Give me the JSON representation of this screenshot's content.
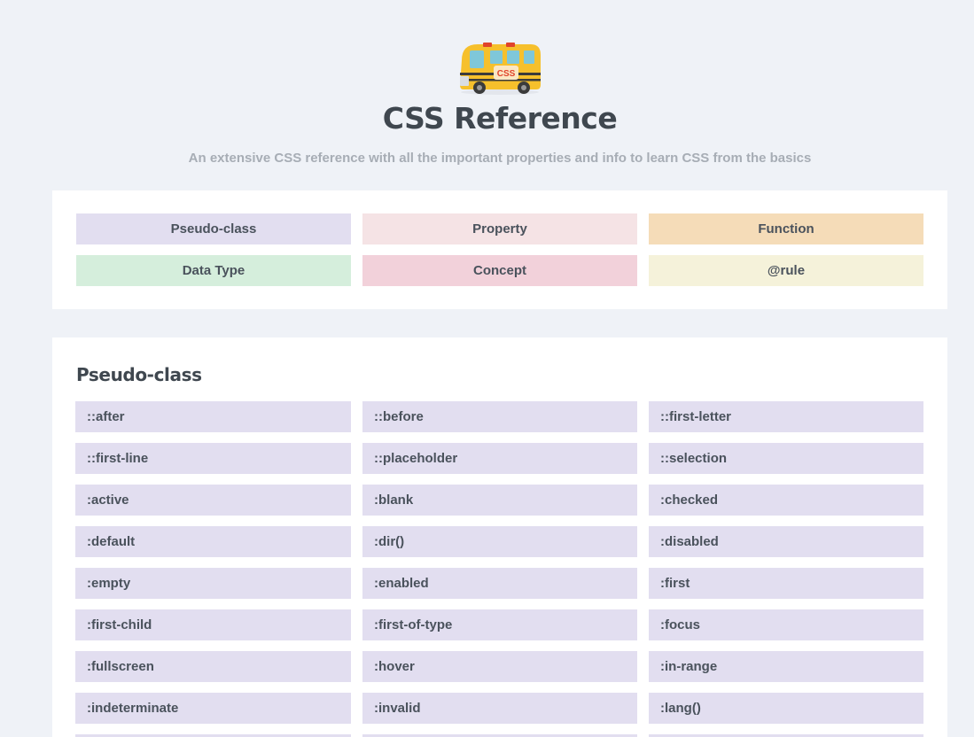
{
  "header": {
    "title": "CSS Reference",
    "subtitle": "An extensive CSS reference with all the important properties and info to learn CSS from the basics",
    "logo_text": "CSS",
    "logo_icon": "school-bus-icon"
  },
  "colors": {
    "background": "#eff2f7",
    "pseudo_class": "#e2def0",
    "property": "#f5e3e5",
    "function": "#f5dcb8",
    "data_type": "#d5eedc",
    "concept": "#f2d1da",
    "at_rule": "#f5f2da"
  },
  "legend": [
    {
      "label": "Pseudo-class",
      "color": "#e2def0"
    },
    {
      "label": "Property",
      "color": "#f5e3e5"
    },
    {
      "label": "Function",
      "color": "#f5dcb8"
    },
    {
      "label": "Data Type",
      "color": "#d5eedc"
    },
    {
      "label": "Concept",
      "color": "#f2d1da"
    },
    {
      "label": "@rule",
      "color": "#f5f2da"
    }
  ],
  "section": {
    "title": "Pseudo-class",
    "items": [
      "::after",
      "::before",
      "::first-letter",
      "::first-line",
      "::placeholder",
      "::selection",
      ":active",
      ":blank",
      ":checked",
      ":default",
      ":dir()",
      ":disabled",
      ":empty",
      ":enabled",
      ":first",
      ":first-child",
      ":first-of-type",
      ":focus",
      ":fullscreen",
      ":hover",
      ":in-range",
      ":indeterminate",
      ":invalid",
      ":lang()",
      "",
      "",
      ""
    ]
  }
}
